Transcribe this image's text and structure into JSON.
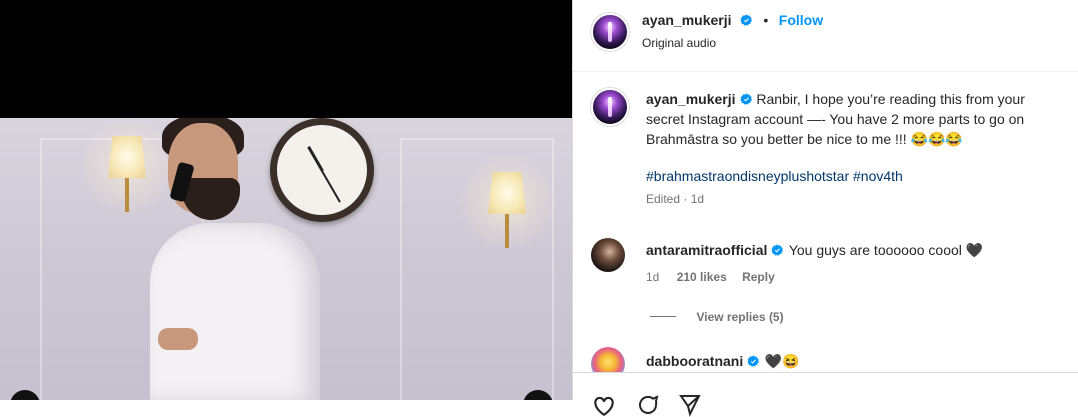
{
  "post": {
    "author": "ayan_mukerji",
    "follow_label": "Follow",
    "dot": "•",
    "audio": "Original audio"
  },
  "caption": {
    "author": "ayan_mukerji",
    "text_line1": "Ranbir, I hope you’re reading this from your",
    "text_line2": "secret Instagram account —- You have 2 more parts to go on",
    "text_line3": "Brahmāstra so you better be nice to me !!! 😂😂😂",
    "hashtags": "#brahmastraondisneyplushotstar #nov4th",
    "edited": "Edited · 1d"
  },
  "comments": [
    {
      "author": "antaramitraofficial",
      "text": "You guys are toooooo coool 🖤",
      "age": "1d",
      "likes": "210 likes",
      "reply_label": "Reply",
      "view_replies": "View replies (5)"
    },
    {
      "author": "dabbooratnani",
      "text": "🖤😆"
    }
  ],
  "colors": {
    "accent": "#0095f6",
    "verified": "#0095f6",
    "hashtag": "#00376b",
    "muted": "#737373",
    "text": "#262626"
  },
  "icons": [
    "verified-badge-icon",
    "like-icon",
    "comment-icon",
    "share-icon"
  ]
}
